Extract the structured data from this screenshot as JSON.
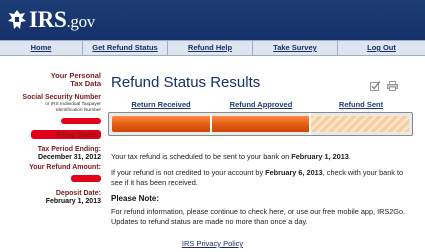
{
  "brand": {
    "name": "IRS",
    "suffix": ".gov"
  },
  "nav": [
    {
      "label": "Home"
    },
    {
      "label": "Get Refund Status"
    },
    {
      "label": "Refund Help"
    },
    {
      "label": "Take Survey"
    },
    {
      "label": "Log Out"
    }
  ],
  "side": {
    "personal_label_1": "Your Personal",
    "personal_label_2": "Tax Data",
    "ssn_label": "Social Security Number",
    "ssn_sub_1": "or IRS Individual Taxpayer",
    "ssn_sub_2": "Identification Number",
    "filing_label": "Filing Status:",
    "period_label": "Tax Period Ending:",
    "period_value": "December 31, 2012",
    "refund_label": "Your Refund Amount:",
    "deposit_label": "Deposit Date:",
    "deposit_value": "February 1, 2013"
  },
  "main": {
    "title": "Refund Status Results",
    "steps": [
      "Return Received",
      "Refund Approved",
      "Refund Sent"
    ],
    "progress": 0.667,
    "msg1_pre": "Your tax refund is scheduled to be sent to your bank on ",
    "msg1_date": "February 1, 2013",
    "msg1_post": ".",
    "msg2_pre": "If your refund is not credited to your account by ",
    "msg2_date": "February 6, 2013",
    "msg2_post": ", check with your bank to see if it has been received.",
    "note_title": "Please Note:",
    "note_text": "For refund information, please continue to check here, or use our free mobile app, IRS2Go. Updates to refund status are made no more than once a day."
  },
  "footer": {
    "privacy": "IRS Privacy Policy"
  },
  "colors": {
    "header": "#16306a",
    "accent": "#e45a12",
    "label": "#7a1c1c"
  },
  "icons": [
    "eagle-logo-icon",
    "checkmark-icon",
    "print-icon"
  ]
}
